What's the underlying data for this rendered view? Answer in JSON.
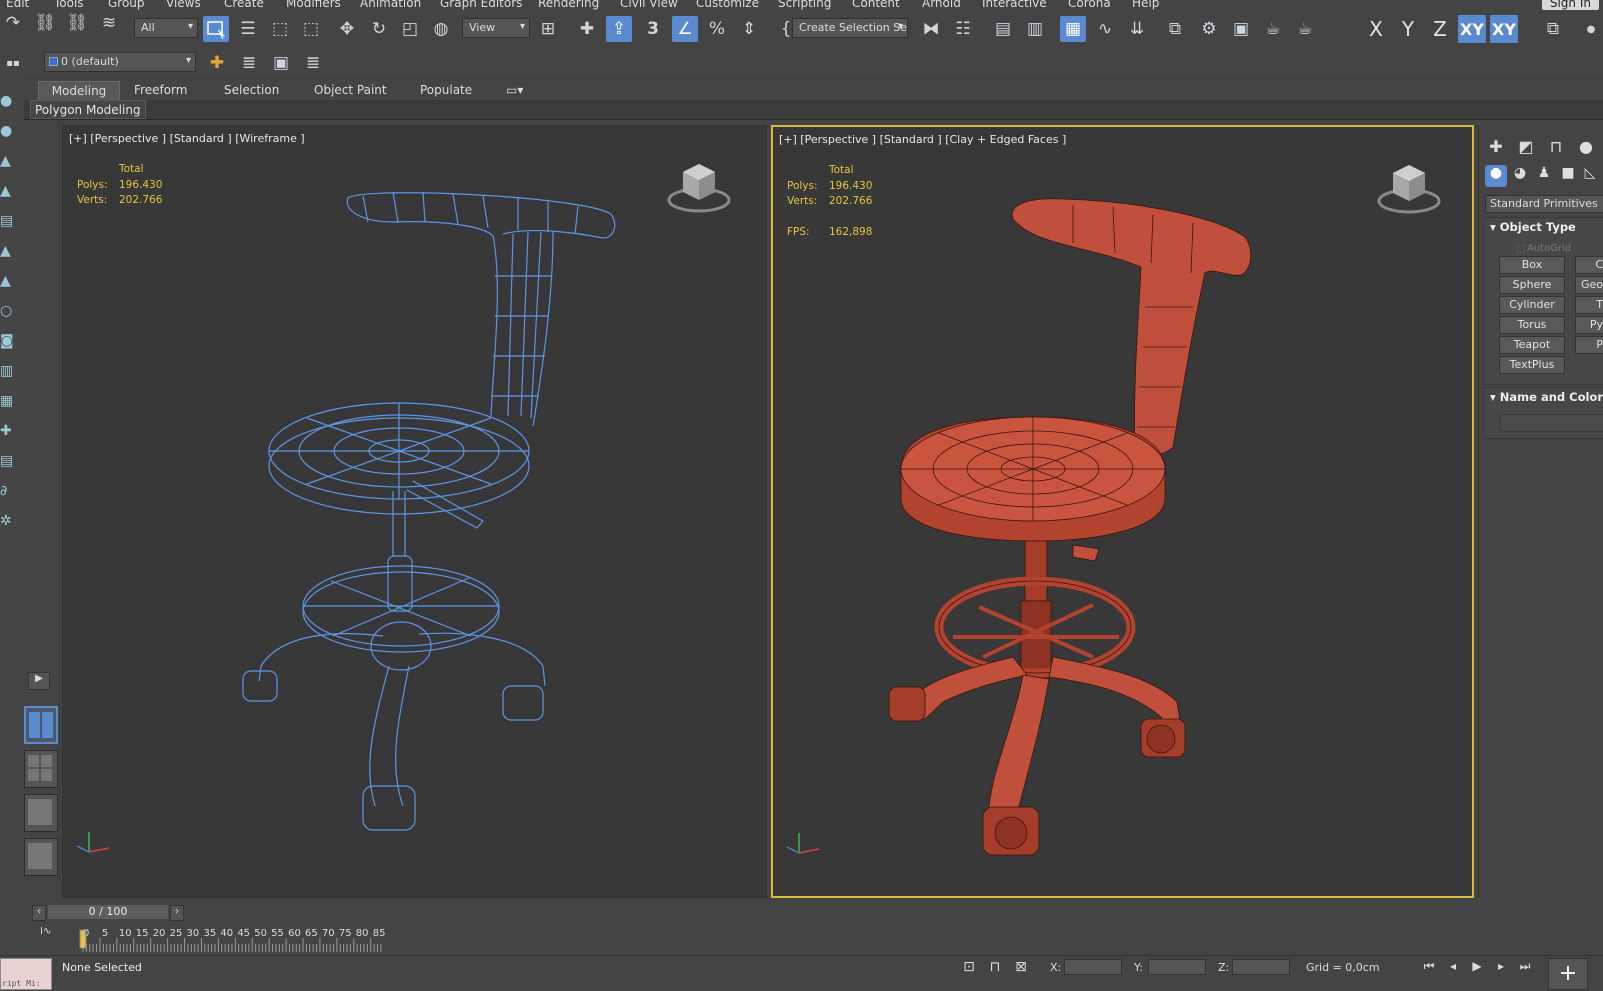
{
  "menu": {
    "items": [
      "Edit",
      "Tools",
      "Group",
      "Views",
      "Create",
      "Modifiers",
      "Animation",
      "Graph Editors",
      "Rendering",
      "Civil View",
      "Customize",
      "Scripting",
      "Content",
      "Arnold",
      "Interactive",
      "Corona",
      "Help"
    ],
    "sign_in": "Sign In"
  },
  "toolbar": {
    "selection_filter": "All",
    "reference_coord": "View",
    "named_selection": "Create Selection Se",
    "layer": "0 (default)",
    "axis": {
      "x": "X",
      "y": "Y",
      "z": "Z",
      "xy": "XY",
      "xy2": "XY"
    },
    "snap_label": "3",
    "percent_label": "%"
  },
  "ribbon": {
    "tabs": [
      "Modeling",
      "Freeform",
      "Selection",
      "Object Paint",
      "Populate"
    ],
    "active_tab": "Modeling",
    "panel": "Polygon Modeling"
  },
  "viewports": {
    "left": {
      "label": "[+] [Perspective ] [Standard ] [Wireframe ]",
      "stats": {
        "total": "Total",
        "polys_label": "Polys:",
        "polys": "196.430",
        "verts_label": "Verts:",
        "verts": "202.766"
      },
      "color": "#5b97e8"
    },
    "right": {
      "label": "[+] [Perspective ] [Standard ] [Clay + Edged Faces ]",
      "stats": {
        "total": "Total",
        "polys_label": "Polys:",
        "polys": "196.430",
        "verts_label": "Verts:",
        "verts": "202.766",
        "fps_label": "FPS:",
        "fps": "162,898"
      },
      "color": "#c0503c"
    }
  },
  "command_panel": {
    "category": "Standard Primitives",
    "object_type_title": "Object Type",
    "autogrid": "AutoGrid",
    "buttons_left": [
      "Box",
      "Sphere",
      "Cylinder",
      "Torus",
      "Teapot",
      "TextPlus"
    ],
    "buttons_right": [
      "C",
      "Geo",
      "T",
      "Py",
      "P"
    ],
    "name_color_title": "Name and Color"
  },
  "timeline": {
    "frame": "0 / 100",
    "ticks": [
      "0",
      "5",
      "10",
      "15",
      "20",
      "25",
      "30",
      "35",
      "40",
      "45",
      "50",
      "55",
      "60",
      "65",
      "70",
      "75",
      "80",
      "85"
    ]
  },
  "status": {
    "maxscript": "ript Mi:",
    "selection": "None Selected",
    "x_label": "X:",
    "y_label": "Y:",
    "z_label": "Z:",
    "grid": "Grid = 0,0cm"
  },
  "colors": {
    "accent": "#5a8bd0",
    "active_viewport_border": "#d8b743",
    "stats_text": "#e6c542",
    "wireframe": "#5b97e8",
    "clay": "#c0503c"
  }
}
